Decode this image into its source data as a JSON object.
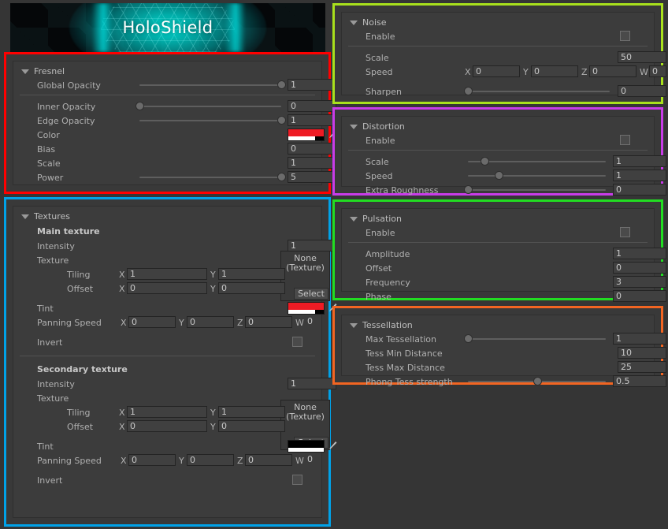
{
  "banner": {
    "title": "HoloShield"
  },
  "groups": {
    "fresnel": {
      "title": "Fresnel",
      "border_color": "#ff0000",
      "rows": {
        "global_opacity": {
          "label": "Global Opacity",
          "value": "1",
          "slider": 1.0
        },
        "inner_opacity": {
          "label": "Inner Opacity",
          "value": "0",
          "slider": 0.0
        },
        "edge_opacity": {
          "label": "Edge Opacity",
          "value": "1",
          "slider": 1.0
        },
        "color": {
          "label": "Color",
          "color": "#ee1b24",
          "alpha": 0.76
        },
        "bias": {
          "label": "Bias",
          "value": "0"
        },
        "scale": {
          "label": "Scale",
          "value": "1"
        },
        "power": {
          "label": "Power",
          "value": "5",
          "slider": 1.0
        }
      }
    },
    "textures": {
      "title": "Textures",
      "border_color": "#00a2e8",
      "main": {
        "heading": "Main texture",
        "intensity": {
          "label": "Intensity",
          "value": "1"
        },
        "texture": {
          "label": "Texture",
          "object": "None",
          "object_type": "(Texture)",
          "select": "Select"
        },
        "tiling": {
          "label": "Tiling",
          "x": "1",
          "y": "1"
        },
        "offset": {
          "label": "Offset",
          "x": "0",
          "y": "0"
        },
        "tint": {
          "label": "Tint",
          "color": "#ee1b24",
          "alpha": 0.76
        },
        "panning": {
          "label": "Panning Speed",
          "x": "0",
          "y": "0",
          "z": "0",
          "w": "0"
        },
        "invert": {
          "label": "Invert",
          "checked": false
        }
      },
      "secondary": {
        "heading": "Secondary texture",
        "intensity": {
          "label": "Intensity",
          "value": "1"
        },
        "texture": {
          "label": "Texture",
          "object": "None",
          "object_type": "(Texture)",
          "select": "Select"
        },
        "tiling": {
          "label": "Tiling",
          "x": "1",
          "y": "1"
        },
        "offset": {
          "label": "Offset",
          "x": "0",
          "y": "0"
        },
        "tint": {
          "label": "Tint",
          "color": "#000000",
          "alpha": 1.0
        },
        "panning": {
          "label": "Panning Speed",
          "x": "0",
          "y": "0",
          "z": "0",
          "w": "0"
        },
        "invert": {
          "label": "Invert",
          "checked": false
        }
      }
    },
    "noise": {
      "title": "Noise",
      "border_color": "#a8e01c",
      "enable": {
        "label": "Enable",
        "checked": false
      },
      "scale": {
        "label": "Scale",
        "value": "50"
      },
      "speed": {
        "label": "Speed",
        "x": "0",
        "y": "0",
        "z": "0",
        "w": "0"
      },
      "sharpen": {
        "label": "Sharpen",
        "value": "0",
        "slider": 0.0
      }
    },
    "distortion": {
      "title": "Distortion",
      "border_color": "#c83ce8",
      "enable": {
        "label": "Enable",
        "checked": false
      },
      "scale": {
        "label": "Scale",
        "value": "1",
        "slider": 0.12
      },
      "speed": {
        "label": "Speed",
        "value": "1",
        "slider": 0.22
      },
      "extra_roughness": {
        "label": "Extra Roughness",
        "value": "0",
        "slider": 0.0
      }
    },
    "pulsation": {
      "title": "Pulsation",
      "border_color": "#22dd22",
      "enable": {
        "label": "Enable",
        "checked": false
      },
      "amplitude": {
        "label": "Amplitude",
        "value": "1"
      },
      "offset": {
        "label": "Offset",
        "value": "0"
      },
      "frequency": {
        "label": "Frequency",
        "value": "3"
      },
      "phase": {
        "label": "Phase",
        "value": "0"
      }
    },
    "tessellation": {
      "title": "Tessellation",
      "border_color": "#f26522",
      "max_tessellation": {
        "label": "Max Tessellation",
        "value": "1",
        "slider": 0.0
      },
      "tess_min_distance": {
        "label": "Tess Min Distance",
        "value": "10"
      },
      "tess_max_distance": {
        "label": "Tess Max Distance",
        "value": "25"
      },
      "phong_tess_strength": {
        "label": "Phong Tess strength",
        "value": "0.5",
        "slider": 0.5
      }
    }
  },
  "icons": {
    "foldout": "triangle-down-icon",
    "eyedropper": "eyedropper-icon"
  }
}
